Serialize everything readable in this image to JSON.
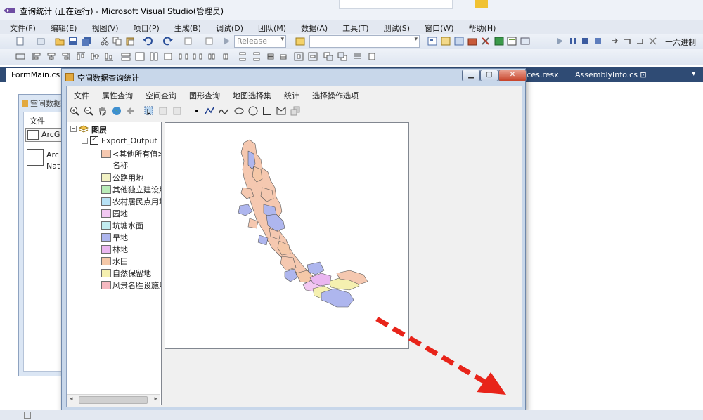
{
  "vs": {
    "title": "查询统计 (正在运行) - Microsoft Visual Studio(管理员)",
    "menu": [
      "文件(F)",
      "编辑(E)",
      "视图(V)",
      "项目(P)",
      "生成(B)",
      "调试(D)",
      "团队(M)",
      "数据(A)",
      "工具(T)",
      "测试(S)",
      "窗口(W)",
      "帮助(H)"
    ],
    "config": "Release",
    "hex_label": "十六进制",
    "tabs": {
      "form_main": "FormMain.cs",
      "resources": "rces.resx",
      "assembly": "AssemblyInfo.cs"
    }
  },
  "bgform": {
    "caption": "空间数据",
    "menu_file": "文件",
    "item1": "ArcG",
    "item2a": "Arc",
    "item2b": "Nat"
  },
  "window": {
    "title": "空间数据查询统计",
    "menu": [
      "文件",
      "属性查询",
      "空间查询",
      "图形查询",
      "地图选择集",
      "统计",
      "选择操作选项"
    ]
  },
  "toc": {
    "root": "图层",
    "layer": "Export_Output",
    "field_label": "名称",
    "classes": [
      {
        "label": "<其他所有值>",
        "color": "#f5c8b0"
      },
      {
        "label": "公路用地",
        "color": "#f2f2c4"
      },
      {
        "label": "其他独立建设用",
        "color": "#b8ecb8"
      },
      {
        "label": "农村居民点用地",
        "color": "#b7e2f5"
      },
      {
        "label": "园地",
        "color": "#f2c8f2"
      },
      {
        "label": "坑塘水面",
        "color": "#c2ecf0"
      },
      {
        "label": "旱地",
        "color": "#aeb6ee"
      },
      {
        "label": "林地",
        "color": "#eab6f0"
      },
      {
        "label": "水田",
        "color": "#f5c8a8"
      },
      {
        "label": "自然保留地",
        "color": "#f5f0b0"
      },
      {
        "label": "风景名胜设施用",
        "color": "#f5b8c0"
      }
    ]
  },
  "colors": {
    "tab_bar": "#2f4b74",
    "arrow": "#e8241a",
    "window_frame": "#c8d7ea"
  }
}
